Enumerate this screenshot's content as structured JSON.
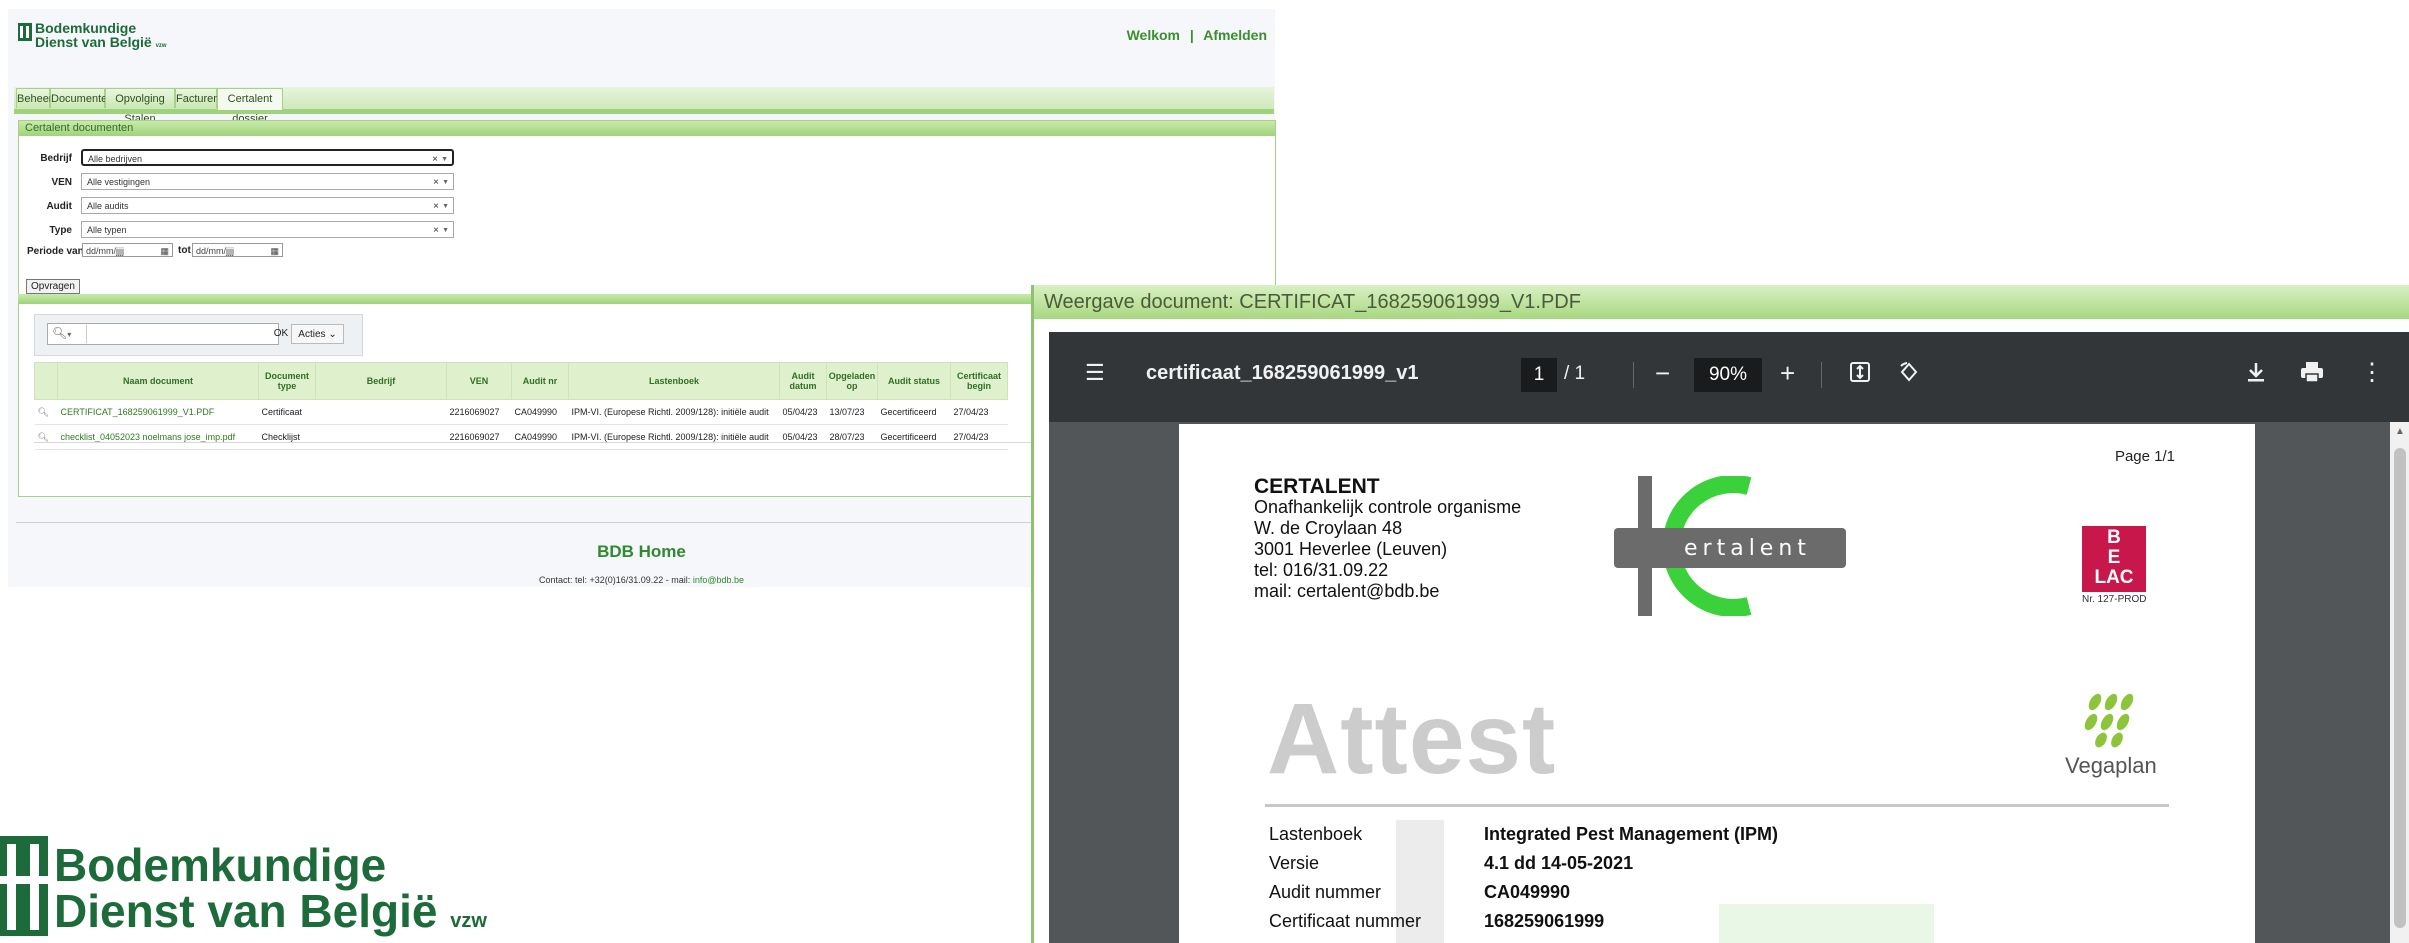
{
  "header": {
    "logo_line1": "Bodemkundige",
    "logo_line2": "Dienst van België",
    "logo_suffix": "vzw",
    "welcome": "Welkom",
    "separator": "|",
    "logout": "Afmelden"
  },
  "tabs": [
    "Beheer",
    "Documenten",
    "Opvolging Stalen",
    "Facturen",
    "Certalent dossier"
  ],
  "active_tab": "Certalent dossier",
  "section": {
    "title": "Certalent documenten",
    "fields": [
      {
        "label": "Bedrijf",
        "value": "Alle bedrijven"
      },
      {
        "label": "VEN",
        "value": "Alle vestigingen"
      },
      {
        "label": "Audit",
        "value": "Alle audits"
      },
      {
        "label": "Type",
        "value": "Alle typen"
      }
    ],
    "period_label": "Periode van",
    "date_placeholder": "dd/mm/jjjj",
    "to_label": "tot",
    "submit": "Opvragen"
  },
  "toolbar": {
    "ok": "OK",
    "actions": "Acties"
  },
  "table": {
    "columns": [
      "Naam document",
      "Document type",
      "Bedrijf",
      "VEN",
      "Audit nr",
      "Lastenboek",
      "Audit datum",
      "Opgeladen op",
      "Audit status",
      "Certificaat begin"
    ],
    "rows": [
      {
        "name": "CERTIFICAT_168259061999_V1.PDF",
        "type": "Certificaat",
        "bedrijf": "",
        "ven": "2216069027",
        "audit": "CA049990",
        "lastenboek": "IPM-VI. (Europese Richtl. 2009/128): initiële audit",
        "datum": "05/04/23",
        "opgeladen": "13/07/23",
        "status": "Gecertificeerd",
        "begin": "27/04/23"
      },
      {
        "name": "checklist_04052023 noelmans jose_imp.pdf",
        "type": "Checklijst",
        "bedrijf": "",
        "ven": "2216069027",
        "audit": "CA049990",
        "lastenboek": "IPM-VI. (Europese Richtl. 2009/128): initiële audit",
        "datum": "05/04/23",
        "opgeladen": "28/07/23",
        "status": "Gecertificeerd",
        "begin": "27/04/23"
      }
    ]
  },
  "footer": {
    "title": "BDB Home",
    "contact": "Contact: tel: +32(0)16/31.09.22 - mail:",
    "mail": "info@bdb.be"
  },
  "viewer": {
    "title": "Weergave document: CERTIFICAT_168259061999_V1.PDF",
    "pdf_name": "certificaat_168259061999_v1",
    "page_current": "1",
    "page_total": "/ 1",
    "zoom": "90%",
    "page_label": "Page 1/1",
    "cert_org": "CERTALENT",
    "cert_lines": [
      "Onafhankelijk controle organisme",
      "W. de Croylaan 48",
      "3001 Heverlee (Leuven)",
      "tel: 016/31.09.22",
      "mail: certalent@bdb.be"
    ],
    "logo_word": "ertalent",
    "belac_lines": [
      "B",
      "E",
      "LAC"
    ],
    "belac_label": "Nr. 127-PROD",
    "vegaplan": "Vegaplan",
    "attest": "Attest",
    "details": [
      {
        "label": "Lastenboek",
        "value": "Integrated Pest Management (IPM)"
      },
      {
        "label": "Versie",
        "value": "4.1 dd 14-05-2021"
      },
      {
        "label": "Audit nummer",
        "value": "CA049990"
      },
      {
        "label": "Certificaat nummer",
        "value": "168259061999"
      }
    ]
  },
  "colors": {
    "brand_green": "#1d6b3a",
    "accent_green": "#3c8d2f",
    "tab_green": "#9fd37b",
    "certalent_green": "#3ad13a"
  }
}
